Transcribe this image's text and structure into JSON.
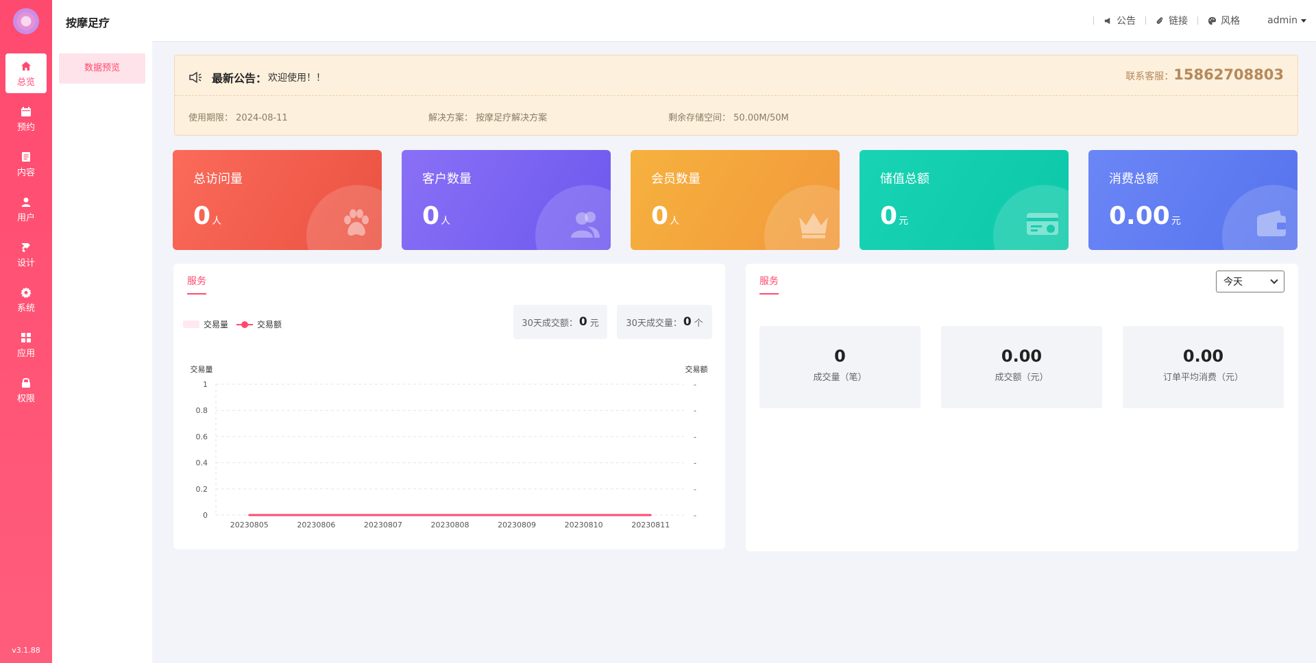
{
  "app": {
    "name": "按摩足疗",
    "version": "v3.1.88"
  },
  "nav": [
    {
      "label": "总览",
      "icon": "home-icon",
      "active": true
    },
    {
      "label": "预约",
      "icon": "calendar-icon"
    },
    {
      "label": "内容",
      "icon": "document-icon"
    },
    {
      "label": "用户",
      "icon": "user-icon"
    },
    {
      "label": "设计",
      "icon": "brush-icon"
    },
    {
      "label": "系统",
      "icon": "gear-icon"
    },
    {
      "label": "应用",
      "icon": "grid-icon"
    },
    {
      "label": "权限",
      "icon": "lock-icon"
    }
  ],
  "subnav": {
    "active_item": "数据预览"
  },
  "header": {
    "links": [
      {
        "label": "公告",
        "icon": "megaphone-icon"
      },
      {
        "label": "链接",
        "icon": "paperclip-icon"
      },
      {
        "label": "风格",
        "icon": "palette-icon"
      }
    ],
    "user": "admin"
  },
  "notice": {
    "title": "最新公告：",
    "message": "欢迎使用！！",
    "contact_label": "联系客服：",
    "contact_phone": "15862708803",
    "expiry_label": "使用期限：",
    "expiry_value": "2024-08-11",
    "solution_label": "解决方案：",
    "solution_value": "按摩足疗解决方案",
    "storage_label": "剩余存储空间：",
    "storage_value": "50.00M/50M"
  },
  "stats": [
    {
      "title": "总访问量",
      "value": "0",
      "unit": "人",
      "icon": "paw-icon",
      "color": "#f2604a"
    },
    {
      "title": "客户数量",
      "value": "0",
      "unit": "人",
      "icon": "users-icon",
      "color": "#7c63f2"
    },
    {
      "title": "会员数量",
      "value": "0",
      "unit": "人",
      "icon": "crown-icon",
      "color": "#f4a43c"
    },
    {
      "title": "储值总额",
      "value": "0",
      "unit": "元",
      "icon": "card-icon",
      "color": "#12cfae"
    },
    {
      "title": "消费总额",
      "value": "0.00",
      "unit": "元",
      "icon": "wallet-icon",
      "color": "#5b78f0"
    }
  ],
  "service_chart_panel": {
    "title": "服务",
    "legend": [
      "交易量",
      "交易额"
    ],
    "kpi_amount_label": "30天成交额：",
    "kpi_amount_value": "0",
    "kpi_amount_unit": "元",
    "kpi_count_label": "30天成交量：",
    "kpi_count_value": "0",
    "kpi_count_unit": "个"
  },
  "chart_data": {
    "type": "line",
    "categories": [
      "20230805",
      "20230806",
      "20230807",
      "20230808",
      "20230809",
      "20230810",
      "20230811"
    ],
    "series": [
      {
        "name": "交易量",
        "values": [
          0,
          0,
          0,
          0,
          0,
          0,
          0
        ]
      },
      {
        "name": "交易额",
        "values": [
          0,
          0,
          0,
          0,
          0,
          0,
          0
        ]
      }
    ],
    "ylabel": "交易量",
    "y2label": "交易额",
    "ylim": [
      0,
      1
    ],
    "yticks": [
      "0",
      "0.2",
      "0.4",
      "0.6",
      "0.8",
      "1"
    ],
    "y2ticks": [
      "-",
      "-",
      "-",
      "-",
      "-",
      "-"
    ],
    "grid": true,
    "colors": {
      "line": "#ff4a6f"
    }
  },
  "service_summary_panel": {
    "title": "服务",
    "range_selected": "今天",
    "metrics": [
      {
        "value": "0",
        "label": "成交量（笔）"
      },
      {
        "value": "0.00",
        "label": "成交额（元）"
      },
      {
        "value": "0.00",
        "label": "订单平均消费（元）"
      }
    ]
  },
  "colors": {
    "accent": "#ff4a6f",
    "notice_bg": "#fdf0dd",
    "contact": "#b4895a"
  }
}
